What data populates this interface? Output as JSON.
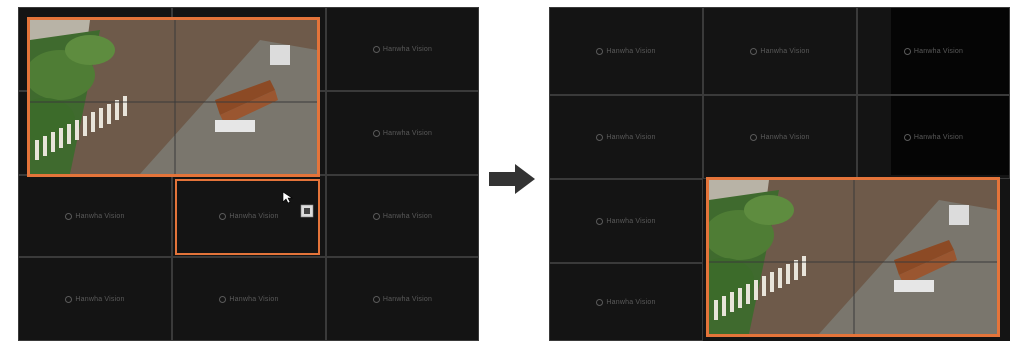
{
  "watermark_text": "Hanwha Vision",
  "colors": {
    "selection": "#e4743a",
    "grid_line": "#3a3a3a",
    "background": "#141414"
  },
  "left_panel": {
    "icons": [
      "cursor-icon",
      "move-icon"
    ]
  },
  "arrow_icon": "right-arrow-icon"
}
